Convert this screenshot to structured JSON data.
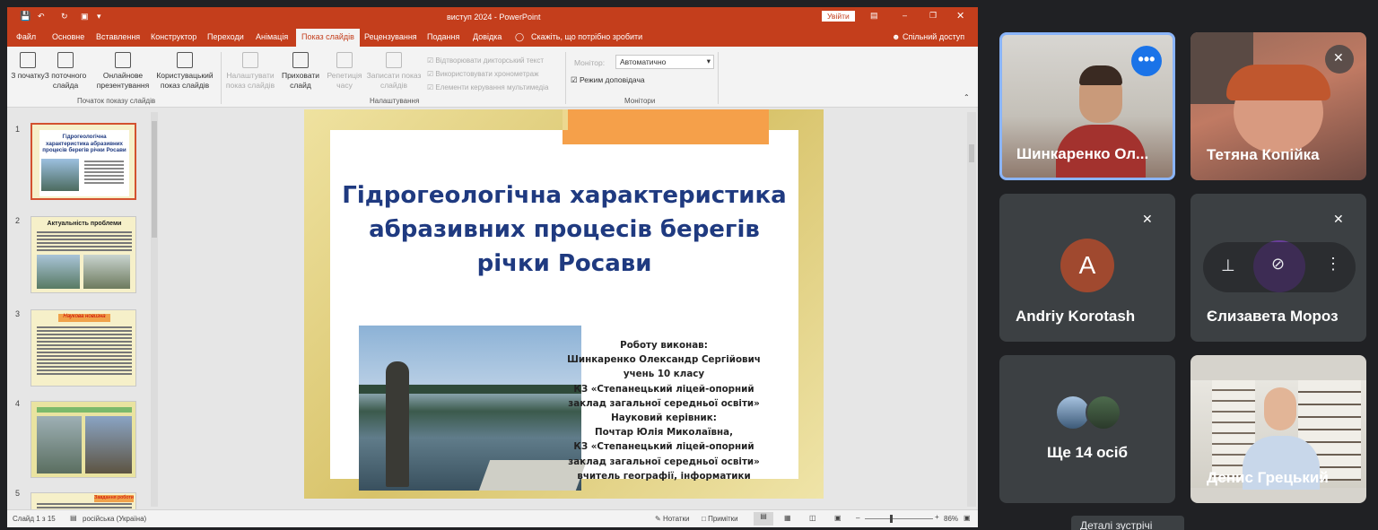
{
  "ppt": {
    "window_title": "виступ 2024  -  PowerPoint",
    "signin": "Увійти",
    "share": "Спільний доступ",
    "tabs": [
      "Файл",
      "Основне",
      "Вставлення",
      "Конструктор",
      "Переходи",
      "Анімація",
      "Показ слайдів",
      "Рецензування",
      "Подання",
      "Довідка"
    ],
    "tell_me": "Скажіть, що потрібно зробити",
    "ribbon": {
      "from_start": "З початку",
      "from_current": "З поточного слайда",
      "online": "Онлайнове презентування",
      "custom": "Користувацький показ слайдів",
      "group_start": "Початок показу слайдів",
      "setup": "Налаштувати показ слайдів",
      "hide": "Приховати слайд",
      "rehearse": "Репетиція часу",
      "record": "Записати показ слайдів",
      "cb_narration": "Відтворювати дикторський текст",
      "cb_timings": "Використовувати хронометраж",
      "cb_media": "Елементи керування мультимедіа",
      "group_setup": "Налаштування",
      "monitor_label": "Монітор:",
      "monitor_value": "Автоматично",
      "presenter_view": "Режим доповідача",
      "group_monitors": "Монітори"
    },
    "thumbnails": {
      "numbers": [
        "1",
        "2",
        "3",
        "4",
        "5"
      ],
      "t1_title": "Гідрогеологічна характеристика абразивних процесів берегів річки Росави",
      "t2_title": "Актуальність проблеми",
      "t3_title": "Наукова новизна",
      "t5_title": "Завдання роботи"
    },
    "slide": {
      "title": "Гідрогеологічна характеристика абразивних процесів берегів річки Росави",
      "author_lines": [
        "Роботу виконав:",
        "Шинкаренко Олександр Сергійович",
        "учень  10  класу",
        "КЗ «Степанецький ліцей-опорний",
        "заклад загальної середньої освіти»",
        "Науковий керівник:",
        "Почтар Юлія Миколаївна,",
        "КЗ «Степанецький ліцей-опорний",
        "заклад загальної середньої освіти»",
        "вчитель географії, інформатики"
      ]
    },
    "status": {
      "slide_count": "Слайд 1 з 15",
      "language": "російська (Україна)",
      "notes": "Нотатки",
      "comments": "Примітки",
      "zoom": "86%"
    }
  },
  "meet": {
    "participants": [
      {
        "name": "Шинкаренко Ол..."
      },
      {
        "name": "Тетяна Копійка"
      },
      {
        "name": "Andriy Korotash",
        "initial": "A"
      },
      {
        "name": "Єлизавета Мороз"
      },
      {
        "name": "Ще 14 осіб"
      },
      {
        "name": "Денис Грецький"
      }
    ],
    "tooltip": "Деталі зустрічі"
  },
  "colors": {
    "ppt_accent": "#c43e1c",
    "meet_bg": "#202124",
    "tile_bg": "#3c4043",
    "slide_title": "#1f3a80",
    "avatar_andriy": "#a0492f",
    "avatar_yelyzaveta": "#6a3e9c",
    "active_border": "#8ab4f8"
  }
}
